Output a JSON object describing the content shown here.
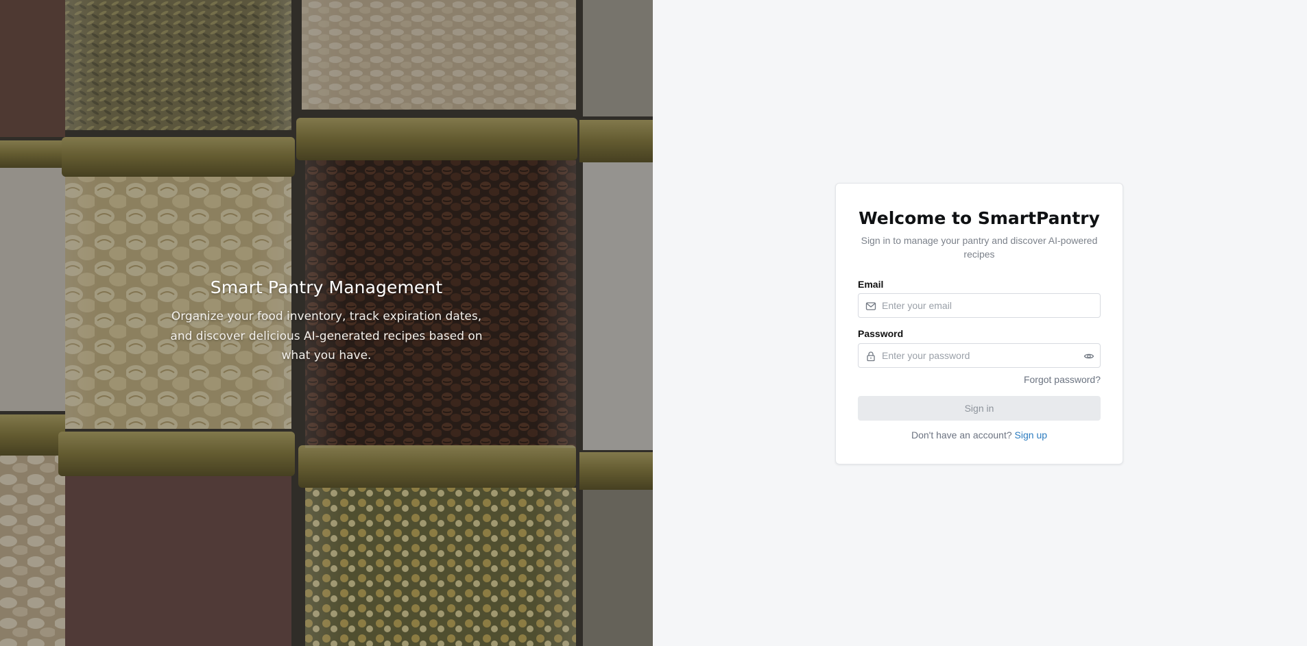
{
  "hero": {
    "title": "Smart Pantry Management",
    "description": "Organize your food inventory, track expiration dates, and discover delicious AI-generated recipes based on what you have."
  },
  "login": {
    "title": "Welcome to SmartPantry",
    "subtitle": "Sign in to manage your pantry and discover AI-powered recipes",
    "email_label": "Email",
    "email_placeholder": "Enter your email",
    "password_label": "Password",
    "password_placeholder": "Enter your password",
    "forgot_password": "Forgot password?",
    "submit": "Sign in",
    "no_account": "Don't have an account?",
    "sign_up": "Sign up"
  },
  "icons": {
    "email": "mail-icon",
    "password": "lock-icon",
    "visibility": "eye-icon"
  },
  "colors": {
    "accent": "#2b7bbf",
    "background": "#f5f6f8",
    "button_disabled": "#e8eaed"
  }
}
